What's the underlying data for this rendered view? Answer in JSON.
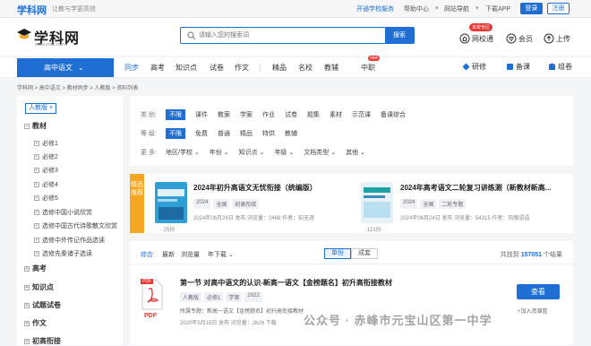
{
  "topbar": {
    "logo": "学科网",
    "slogan": "让教与学更高效",
    "links": [
      "开通学校服务",
      "帮助中心",
      "网站导航",
      "下载APP"
    ],
    "login": "登录",
    "register": "注册"
  },
  "header": {
    "brand": "学科网",
    "brand_url": "www.zxxk.com",
    "search_placeholder": "请输入您的搜索词",
    "search_button": "搜索",
    "school_badge": "本校专区",
    "icons": [
      {
        "label": "网校通",
        "icon": "school-icon"
      },
      {
        "label": "会员",
        "icon": "member-icon"
      },
      {
        "label": "上传",
        "icon": "upload-icon"
      }
    ]
  },
  "nav": {
    "stage": "高中语文",
    "items": [
      "同步",
      "高考",
      "知识点",
      "试卷",
      "作文",
      "精品",
      "名校",
      "教辅",
      "中职"
    ],
    "active": "同步",
    "new_badge": "new",
    "tools": [
      "研修",
      "备课",
      "组卷"
    ]
  },
  "breadcrumb": "学科网  >  高中语文  >  教材同步  >  人教版  >  资料列表",
  "sidebar": {
    "tag": "人教版 ×",
    "section_textbook": "教材",
    "items": [
      "必修1",
      "必修2",
      "必修3",
      "必修4",
      "必修5",
      "选修中国小说欣赏",
      "选修中国古代诗歌散文欣赏",
      "选修中外传记作品选读",
      "选修先秦诸子选读"
    ],
    "sections": [
      "高考",
      "知识点",
      "试题试卷",
      "作文",
      "初高衔接"
    ]
  },
  "filters": {
    "category": {
      "label": "类 别:",
      "options": [
        "不限",
        "课件",
        "教案",
        "学案",
        "作业",
        "试卷",
        "题集",
        "素材",
        "示范课",
        "备课综合"
      ],
      "selected": "不限"
    },
    "level": {
      "label": "等 级:",
      "options": [
        "不限",
        "免费",
        "普通",
        "精品",
        "特供",
        "教辅"
      ],
      "selected": "不限"
    },
    "more": {
      "label": "更 多:",
      "options": [
        "地区/学校",
        "年份",
        "知识点",
        "年级",
        "文档类型",
        "其他"
      ]
    }
  },
  "featured": {
    "ribbon": "精品推荐",
    "cards": [
      {
        "title": "2024年初升高语文无忧衔接（统编版）",
        "tags": [
          "2024",
          "全国",
          "初高衔接"
        ],
        "meta": "2024年06月24日 发布   浏览量：2468   作者：知无涯",
        "pages": "· 25份 ·"
      },
      {
        "title": "2024年高考语文二轮复习讲练测（新教材新高...",
        "tags": [
          "2024",
          "全国",
          "二轮专题"
        ],
        "meta": "2024年06月24日 发布   浏览量：54315   作者：风眼语语",
        "pages": "· 121份 ·"
      }
    ]
  },
  "list": {
    "sorts": [
      "综合",
      "最新",
      "浏览量",
      "年下载"
    ],
    "active_sort": "综合",
    "segments": [
      "单份",
      "成套"
    ],
    "active_segment": "单份",
    "total_prefix": "共找到",
    "total": "157051",
    "total_suffix": "个结果",
    "item": {
      "type": "PDF",
      "title": "第一节 对高中语文的认识-新高一语文【金榜题名】初升高衔接教材",
      "tags": [
        "人教版",
        "必修1",
        "学案",
        "2022"
      ],
      "desc": "所属专题：新高一语文【金榜题名】初升高衔接教材",
      "meta": "2020年5月15日 发布   浏览量：2626   下载",
      "view": "查看",
      "add": "+加入资源篮"
    }
  },
  "watermark": "公众号 · 赤峰市元宝山区第一中学",
  "colors": {
    "accent": "#1f6ed4",
    "featured": "#f5a623",
    "new": "#e53935"
  }
}
